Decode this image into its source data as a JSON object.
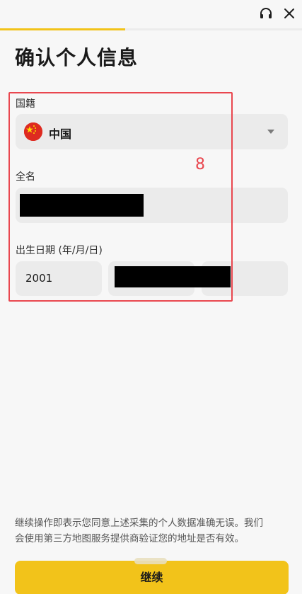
{
  "header": {
    "support_icon": "headset-icon",
    "close_icon": "close-icon",
    "progress_percent": 41.5
  },
  "page_title": "确认个人信息",
  "nationality": {
    "label": "国籍",
    "value": "中国",
    "flag_icon": "china-flag-icon"
  },
  "full_name": {
    "label": "全名"
  },
  "date_of_birth": {
    "label": "出生日期 (年/月/日)",
    "year": "2001"
  },
  "annotation": {
    "number": "8",
    "color": "#e9474f"
  },
  "consent": {
    "line1": "继续操作即表示您同意上述采集的个人数据准确无误。我们",
    "line2": "会使用第三方地图服务提供商验证您的地址是否有效。"
  },
  "continue_button": {
    "label": "继续"
  },
  "colors": {
    "accent": "#f2c31a",
    "field_background": "#ebebeb",
    "page_background": "#f7f7f7"
  }
}
